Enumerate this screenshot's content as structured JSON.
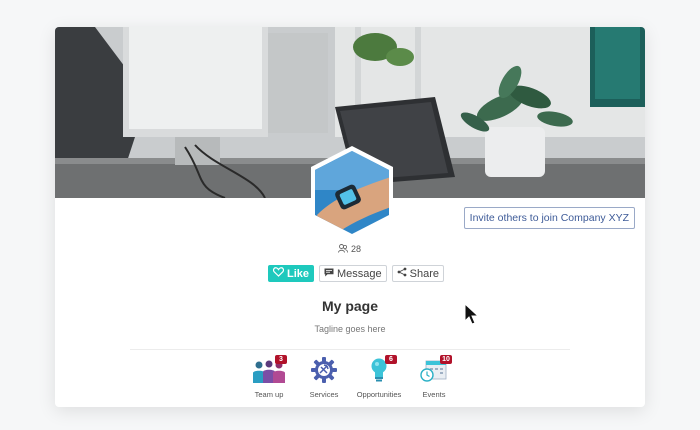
{
  "profile": {
    "member_count": "28",
    "invite_label": "Invite others to join Company XYZ",
    "title": "My page",
    "tagline": "Tagline goes here"
  },
  "actions": {
    "like_label": "Like",
    "message_label": "Message",
    "share_label": "Share"
  },
  "tiles": [
    {
      "label": "Team up",
      "badge": "3",
      "icon": "team-icon"
    },
    {
      "label": "Services",
      "badge": "",
      "icon": "gear-icon"
    },
    {
      "label": "Opportunities",
      "badge": "6",
      "icon": "lightbulb-icon"
    },
    {
      "label": "Events",
      "badge": "10",
      "icon": "calendar-clock-icon"
    }
  ],
  "colors": {
    "like_accent": "#1ec9bd",
    "badge_red": "#b1122a",
    "invite_blue": "#3e5b98"
  }
}
